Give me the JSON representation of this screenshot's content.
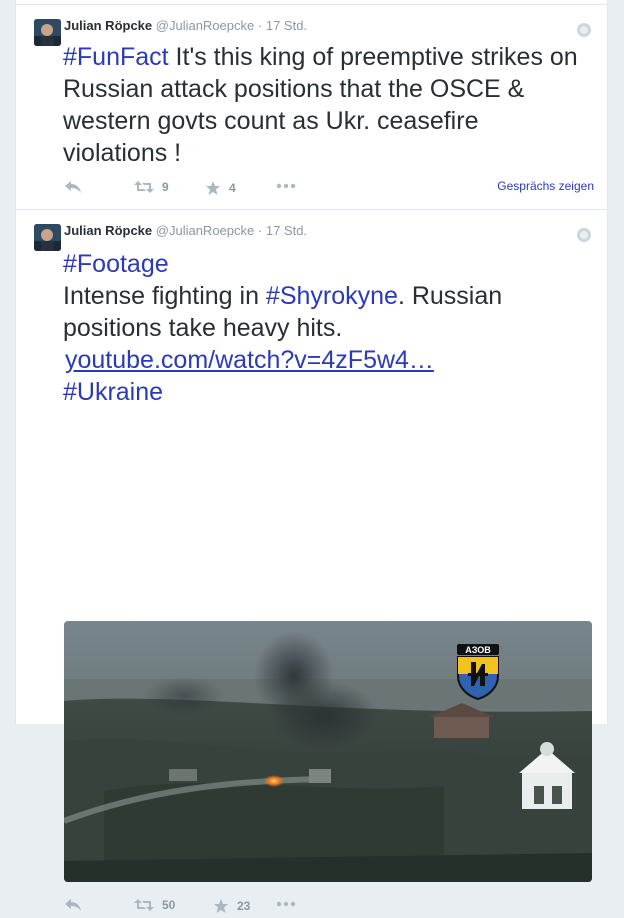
{
  "tweets": [
    {
      "fullname": "Julian Röpcke",
      "handle": "@JulianRoepcke",
      "separator": "·",
      "time": "17 Std.",
      "hashtag": "#FunFact",
      "text_rest": " It's this king of preemptive strikes on Russian attack positions that the OSCE & western govts count as Ukr. ceasefire violations !",
      "retweets": "9",
      "favorites": "4",
      "conversation_label": "Gesprächs zeigen"
    },
    {
      "fullname": "Julian Röpcke",
      "handle": "@JulianRoepcke",
      "separator": "·",
      "time": "17 Std.",
      "hashtag_footage": "#Footage",
      "line_pre": "Intense fighting in ",
      "hashtag_shyrokyne": "#Shyrokyne",
      "line_post": ". Russian positions take heavy hits.",
      "link": "youtube.com/watch?v=4zF5w4…",
      "hashtag_ukraine": "#Ukraine",
      "media_logo_text": "АЗОВ",
      "retweets": "50",
      "favorites": "23"
    }
  ],
  "icons": {
    "reply": "reply-icon",
    "retweet": "retweet-icon",
    "favorite": "star-icon",
    "more": "more-icon",
    "globe": "globe-icon"
  },
  "colors": {
    "link": "#2b3ab9",
    "text": "#292f33",
    "meta": "#8899a6"
  }
}
